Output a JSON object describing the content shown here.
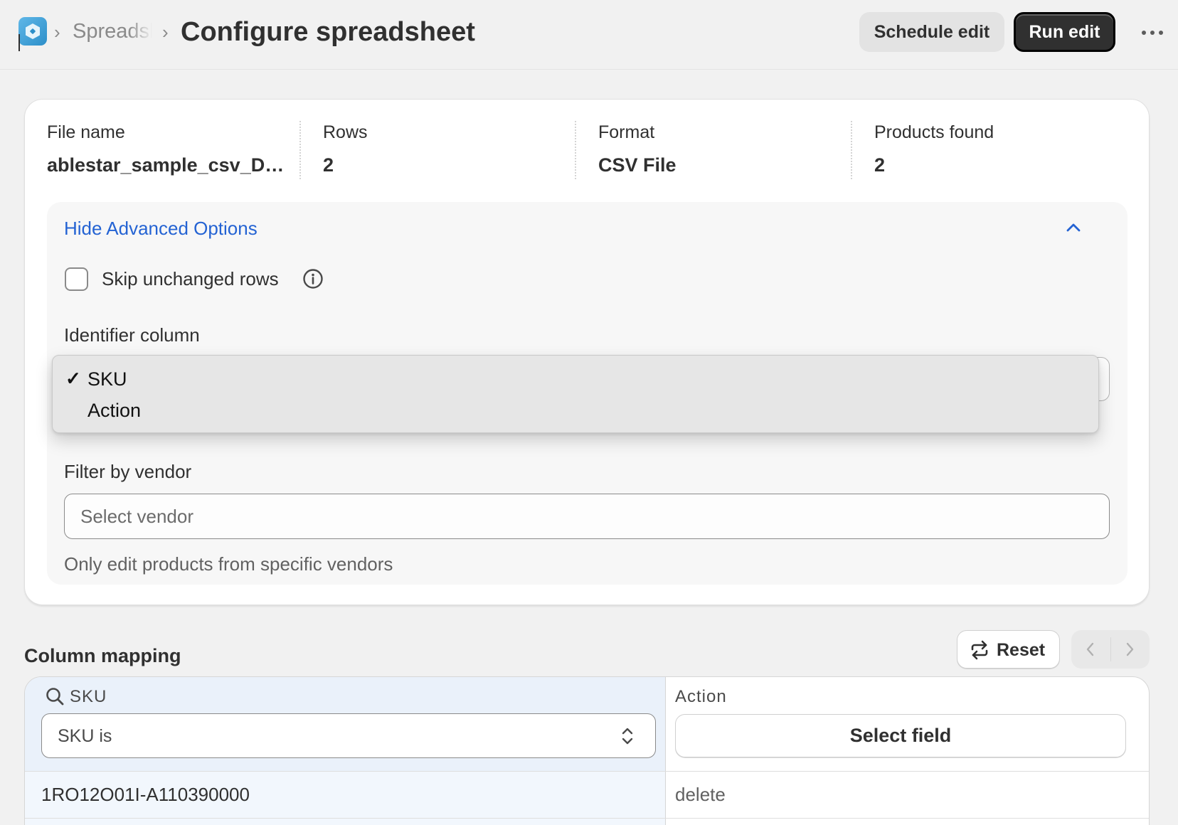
{
  "header": {
    "breadcrumb_parent": "Spreadsheets",
    "breadcrumb_separator": "›",
    "title": "Configure spreadsheet",
    "schedule_label": "Schedule edit",
    "run_label": "Run edit",
    "more_icon": "more-horizontal-icon"
  },
  "summary": {
    "file_name_label": "File name",
    "file_name_value": "ablestar_sample_csv_DA...",
    "rows_label": "Rows",
    "rows_value": "2",
    "format_label": "Format",
    "format_value": "CSV File",
    "products_label": "Products found",
    "products_value": "2"
  },
  "advanced": {
    "toggle_label": "Hide Advanced Options",
    "skip_unchanged_label": "Skip unchanged rows",
    "skip_unchanged_checked": false,
    "identifier_label": "Identifier column",
    "identifier_options": [
      "SKU",
      "Action"
    ],
    "identifier_selected": "SKU",
    "check_mark": "✓",
    "vendor_label": "Filter by vendor",
    "vendor_placeholder": "Select vendor",
    "vendor_help": "Only edit products from specific vendors"
  },
  "mapping": {
    "title": "Column mapping",
    "reset_label": "Reset",
    "columns": [
      {
        "header": "SKU",
        "select_value": "SKU is"
      },
      {
        "header": "Action",
        "button_label": "Select field"
      }
    ],
    "rows": [
      [
        "1RO12O01I-A110390000",
        "delete"
      ]
    ]
  },
  "colors": {
    "accent_link": "#2463d3",
    "primary_button": "#303030",
    "selected_column": "#eaf1fa"
  }
}
